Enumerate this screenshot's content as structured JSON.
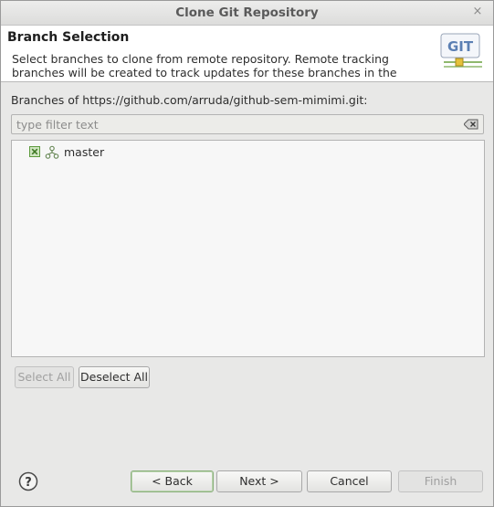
{
  "window": {
    "title": "Clone Git Repository",
    "close_glyph": "×"
  },
  "header": {
    "title": "Branch Selection",
    "description": "Select branches to clone from remote repository. Remote tracking branches will be created to track updates for these branches in the remote repository.",
    "logo_text": "GIT"
  },
  "branches": {
    "label": "Branches of https://github.com/arruda/github-sem-mimimi.git:",
    "filter_placeholder": "type filter text",
    "filter_value": "",
    "items": [
      {
        "name": "master",
        "checked": true,
        "icon": "branch-icon"
      }
    ]
  },
  "selection_buttons": {
    "select_all": "Select All",
    "deselect_all": "Deselect All"
  },
  "footer": {
    "back": "< Back",
    "next": "Next >",
    "cancel": "Cancel",
    "finish": "Finish",
    "help_glyph": "?"
  },
  "colors": {
    "check_green": "#5c9a3c",
    "logo_blue": "#5b7fb3",
    "logo_yellow": "#e6c13a"
  }
}
